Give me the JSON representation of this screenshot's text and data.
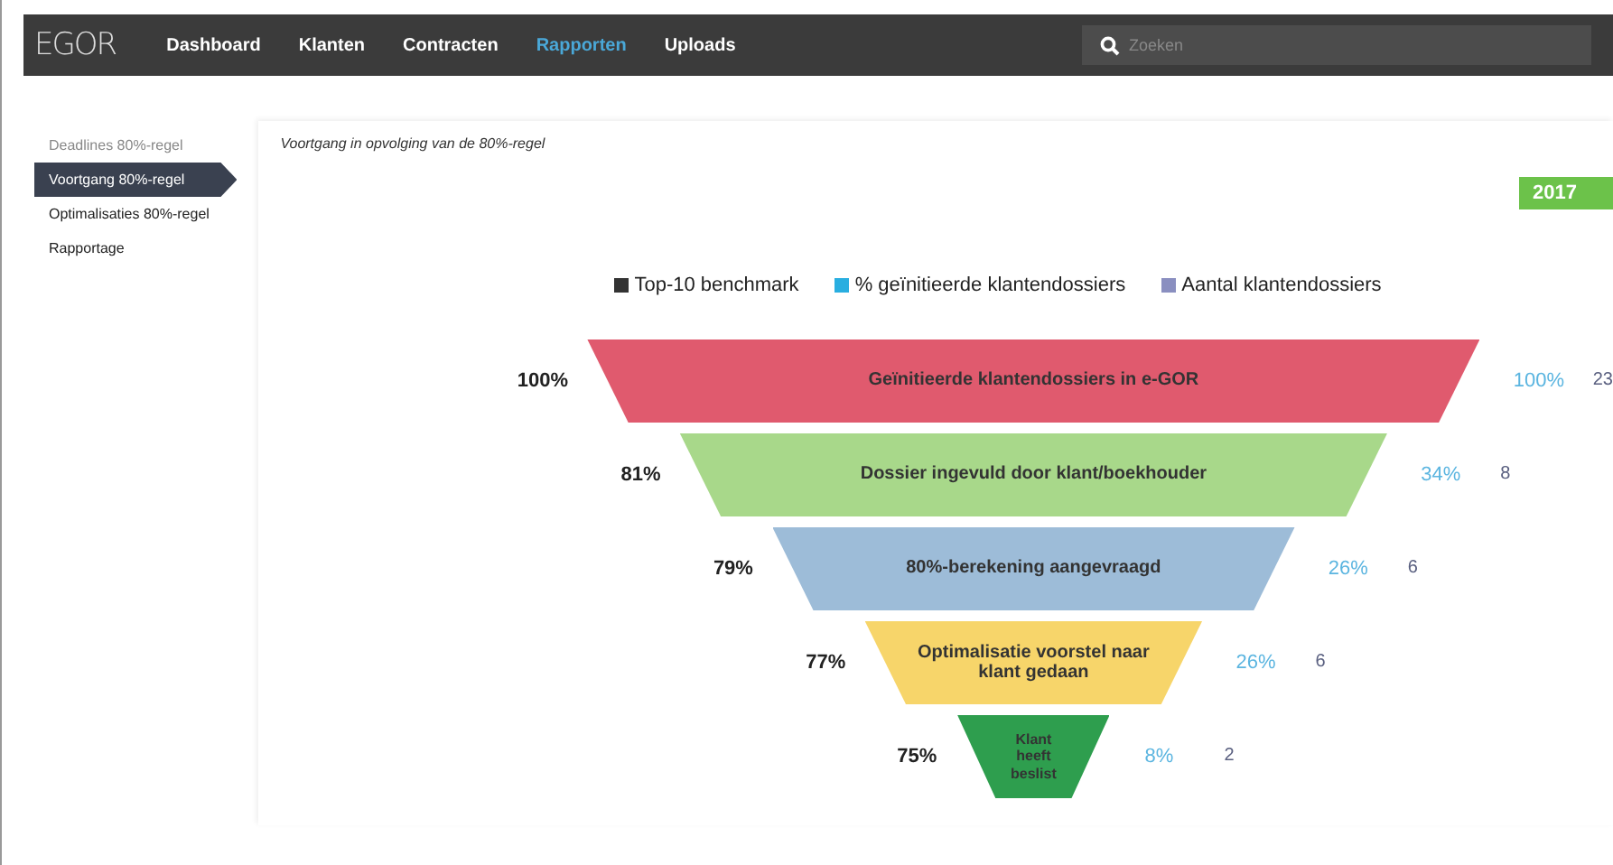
{
  "navbar": {
    "logo": "EGOR",
    "items": [
      {
        "label": "Dashboard",
        "selected": false
      },
      {
        "label": "Klanten",
        "selected": false
      },
      {
        "label": "Contracten",
        "selected": false
      },
      {
        "label": "Rapporten",
        "selected": true
      },
      {
        "label": "Uploads",
        "selected": false
      }
    ],
    "search": {
      "placeholder": "Zoeken"
    }
  },
  "sidebar": {
    "items": [
      {
        "label": "Deadlines 80%-regel",
        "selected": false
      },
      {
        "label": "Voortgang 80%-regel",
        "selected": true
      },
      {
        "label": "Optimalisaties 80%-regel",
        "selected": false
      },
      {
        "label": "Rapportage",
        "selected": false
      }
    ]
  },
  "content": {
    "title": "Voortgang in opvolging van de 80%-regel",
    "year": "2017",
    "legend": [
      {
        "label": "Top-10 benchmark",
        "color": "#333333"
      },
      {
        "label": "% geïnitieerde klantendossiers",
        "color": "#29aee0"
      },
      {
        "label": "Aantal klantendossiers",
        "color": "#8a8fc0"
      }
    ],
    "funnel": [
      {
        "label": "Geïnitieerde klantendossiers in e-GOR",
        "color": "#e05a6e",
        "benchmark": "100%",
        "percent": "100%",
        "count": "23"
      },
      {
        "label": "Dossier ingevuld door klant/boekhouder",
        "color": "#a8d88a",
        "benchmark": "81%",
        "percent": "34%",
        "count": "8"
      },
      {
        "label": "80%-berekening aangevraagd",
        "color": "#9dbcd8",
        "benchmark": "79%",
        "percent": "26%",
        "count": "6"
      },
      {
        "label": "Optimalisatie voorstel naar klant gedaan",
        "color": "#f7d56a",
        "benchmark": "77%",
        "percent": "26%",
        "count": "6"
      },
      {
        "label": "Klant heeft beslist",
        "color": "#2e9e4e",
        "benchmark": "75%",
        "percent": "8%",
        "count": "2"
      }
    ]
  }
}
